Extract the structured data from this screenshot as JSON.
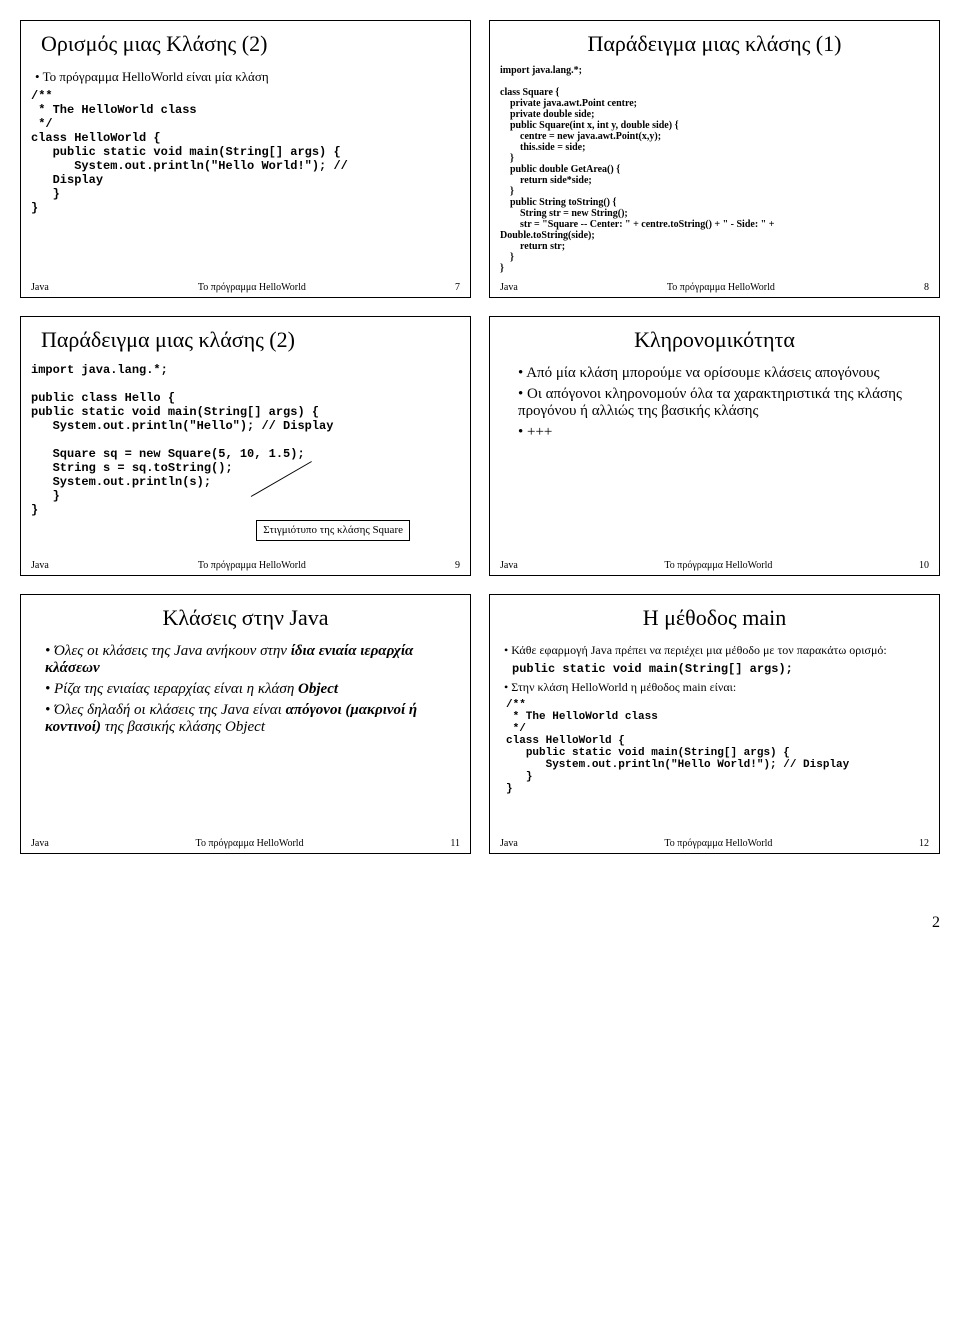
{
  "docFooter": {
    "left": "Java",
    "center": "Το πρόγραμμα HelloWorld"
  },
  "pageNumber": "2",
  "slides": {
    "s7": {
      "title": "Ορισμός μιας Κλάσης (2)",
      "bullet1": "Το πρόγραμμα HelloWorld είναι μία κλάση",
      "code": "/**\n * The HelloWorld class\n */\nclass HelloWorld {\n   public static void main(String[] args) {\n      System.out.println(\"Hello World!\"); //\n   Display\n   }\n}",
      "num": "7"
    },
    "s8": {
      "title": "Παράδειγμα μιας κλάσης (1)",
      "code": "import java.lang.*;\n\nclass Square {\n    private java.awt.Point centre;\n    private double side;\n    public Square(int x, int y, double side) {\n        centre = new java.awt.Point(x,y);\n        this.side = side;\n    }\n    public double GetArea() {\n        return side*side;\n    }\n    public String toString() {\n        String str = new String();\n        str = \"Square -- Center: \" + centre.toString() + \" - Side: \" + \nDouble.toString(side);\n        return str;\n    }\n}",
      "num": "8"
    },
    "s9": {
      "title": "Παράδειγμα μιας κλάσης (2)",
      "code": "import java.lang.*;\n\npublic class Hello {\npublic static void main(String[] args) {\n   System.out.println(\"Hello\"); // Display\n\n   Square sq = new Square(5, 10, 1.5);\n   String s = sq.toString();\n   System.out.println(s);\n   }\n}",
      "callout": "Στιγμιότυπο της κλάσης Square",
      "num": "9"
    },
    "s10": {
      "title": "Κληρονομικότητα",
      "b1": "Από μία κλάση μπορούμε να ορίσουμε κλάσεις απογόνους",
      "b2": "Οι απόγονοι κληρονομούν όλα τα χαρακτηριστικά της κλάσης προγόνου ή αλλιώς της βασικής κλάσης",
      "b3": "+++",
      "num": "10"
    },
    "s11": {
      "title": "Κλάσεις στην Java",
      "b1a": "Όλες οι κλάσεις της Java ανήκουν στην ",
      "b1b": "ίδια ενιαία ιεραρχία κλάσεων",
      "b2a": "Ρίζα της ενιαίας ιεραρχίας είναι η κλάση ",
      "b2b": "Object",
      "b3a": "Όλες δηλαδή οι κλάσεις της Java είναι ",
      "b3b": "απόγονοι (μακρινοί ή κοντινοί)",
      "b3c": " της βασικής κλάσης Object",
      "num": "11"
    },
    "s12": {
      "title": "Η μέθοδος main",
      "b1": "Κάθε εφαρμογή Java πρέπει να περιέχει μια μέθοδο με τον παρακάτω ορισμό:",
      "code1": "public static void main(String[] args);",
      "b2": "Στην κλάση HelloWorld η μέθοδος main είναι:",
      "code2": "/**\n * The HelloWorld class\n */\nclass HelloWorld {\n   public static void main(String[] args) {\n      System.out.println(\"Hello World!\"); // Display\n   }\n}",
      "num": "12"
    }
  }
}
